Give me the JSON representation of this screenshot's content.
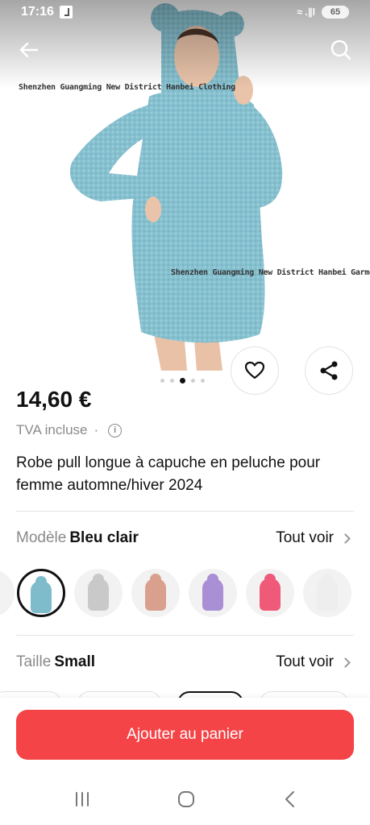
{
  "status_bar": {
    "time": "17:16",
    "battery": "65",
    "signal": "≈ .∥l"
  },
  "hero": {
    "watermark_1": "Shenzhen Guangming New District Hanbei Clothing",
    "watermark_2": "Shenzhen Guangming New District Hanbei Garment Factory",
    "dress_color": "#86c0cf",
    "image_count": 5,
    "active_image": 3
  },
  "product": {
    "price": "14,60 €",
    "tax_label": "TVA incluse",
    "tax_separator": "·",
    "title": "Robe pull longue à capuche en peluche pour femme automne/hiver 2024"
  },
  "model_option": {
    "label": "Modèle",
    "value": "Bleu clair",
    "see_all": "Tout voir",
    "swatch_colors": [
      "#7fbccb",
      "#c9c9c9",
      "#d9a08d",
      "#a98fd4",
      "#ef5a78",
      "#eeeeee"
    ]
  },
  "size_option": {
    "label": "Taille",
    "value": "Small",
    "see_all": "Tout voir"
  },
  "cart": {
    "button_label": "Ajouter au panier"
  },
  "colors": {
    "accent": "#f44447",
    "muted_text": "#8a8a8a"
  },
  "icons": [
    "back-arrow-icon",
    "search-icon",
    "heart-icon",
    "share-icon",
    "info-icon",
    "chevron-right-icon",
    "recents-icon",
    "home-icon",
    "back-icon"
  ]
}
